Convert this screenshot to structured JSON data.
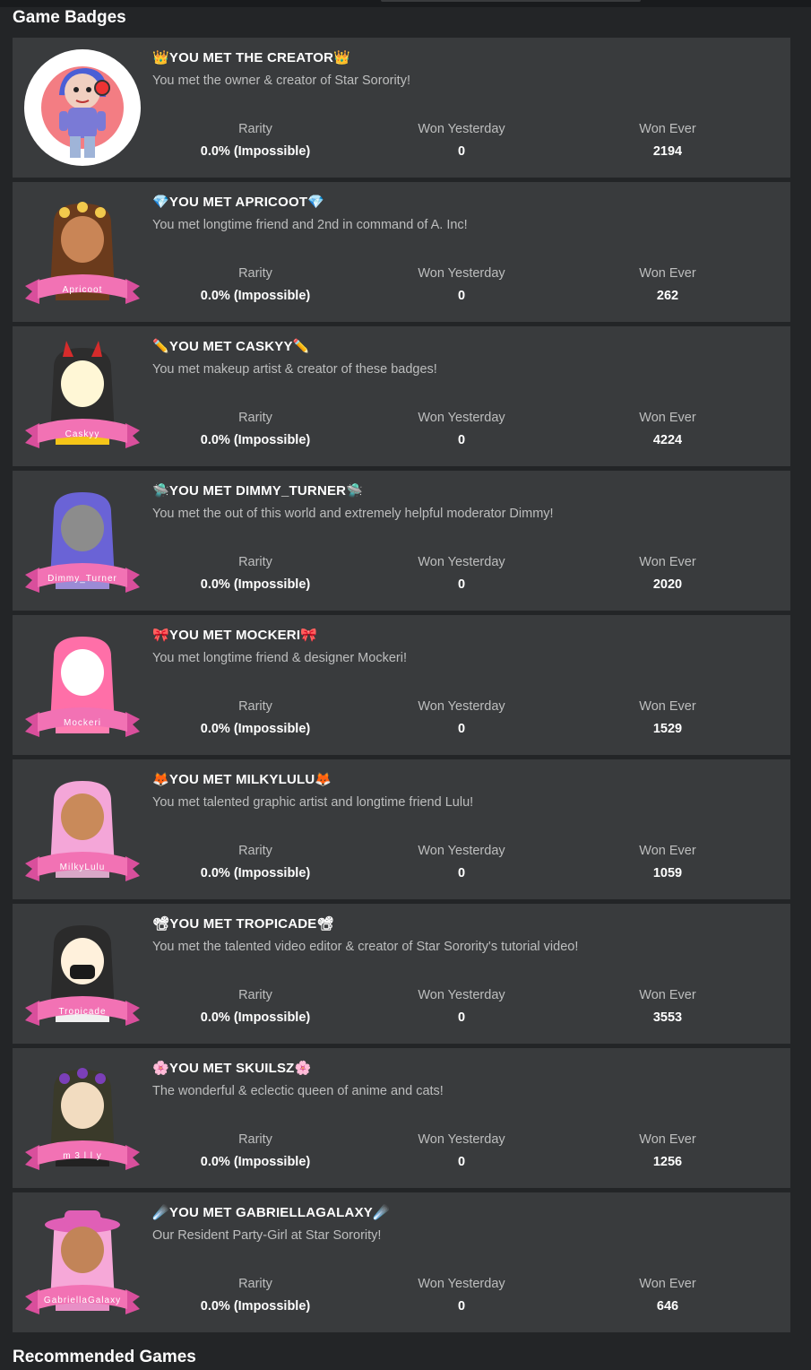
{
  "headings": {
    "game_badges": "Game Badges",
    "recommended_games": "Recommended Games"
  },
  "stat_labels": {
    "rarity": "Rarity",
    "won_yesterday": "Won Yesterday",
    "won_ever": "Won Ever"
  },
  "colors": {
    "page_background": "#232527",
    "card_background": "#393b3d",
    "secondary_text": "#bdbebe",
    "banner_pink": "#f272b4"
  },
  "badges": [
    {
      "icon": "crown-emoji",
      "name": "👑YOU MET THE CREATOR👑",
      "description": "You met the owner & creator of Star Sorority!",
      "rarity": "0.0% (Impossible)",
      "won_yesterday": "0",
      "won_ever": "2194",
      "image": "creator-avatar-circle"
    },
    {
      "icon": "gem-emoji",
      "name": "💎YOU MET APRICOOT💎",
      "description": "You met longtime friend and 2nd in command of A. Inc!",
      "rarity": "0.0% (Impossible)",
      "won_yesterday": "0",
      "won_ever": "262",
      "image": "avatar-with-banner",
      "banner": "Apricoot"
    },
    {
      "icon": "pencil-emoji",
      "name": "✏️YOU MET CASKYY✏️",
      "description": "You met makeup artist & creator of these badges!",
      "rarity": "0.0% (Impossible)",
      "won_yesterday": "0",
      "won_ever": "4224",
      "image": "avatar-with-banner",
      "banner": "Caskyy"
    },
    {
      "icon": "ufo-emoji",
      "name": "🛸YOU MET DIMMY_TURNER🛸",
      "description": "You met the out of this world and extremely helpful moderator Dimmy!",
      "rarity": "0.0% (Impossible)",
      "won_yesterday": "0",
      "won_ever": "2020",
      "image": "avatar-with-banner",
      "banner": "Dimmy_Turner"
    },
    {
      "icon": "ribbon-emoji",
      "name": "🎀YOU MET MOCKERI🎀",
      "description": "You met longtime friend & designer Mockeri!",
      "rarity": "0.0% (Impossible)",
      "won_yesterday": "0",
      "won_ever": "1529",
      "image": "avatar-with-banner",
      "banner": "Mockeri"
    },
    {
      "icon": "fox-emoji",
      "name": "🦊YOU MET MILKYLULU🦊",
      "description": "You met talented graphic artist and longtime friend Lulu!",
      "rarity": "0.0% (Impossible)",
      "won_yesterday": "0",
      "won_ever": "1059",
      "image": "avatar-with-banner",
      "banner": "MilkyLulu"
    },
    {
      "icon": "film-camera-emoji",
      "name": "📽YOU MET TROPICADE📽",
      "description": "You met the talented video editor & creator of Star Sorority's tutorial video!",
      "rarity": "0.0% (Impossible)",
      "won_yesterday": "0",
      "won_ever": "3553",
      "image": "avatar-with-banner",
      "banner": "Tropicade"
    },
    {
      "icon": "cherry-blossom-emoji",
      "name": "🌸YOU MET SKUILSZ🌸",
      "description": "The wonderful & eclectic queen of anime and cats!",
      "rarity": "0.0% (Impossible)",
      "won_yesterday": "0",
      "won_ever": "1256",
      "image": "avatar-with-banner",
      "banner": "m 3 l l y"
    },
    {
      "icon": "comet-emoji",
      "name": "☄️YOU MET GABRIELLAGALAXY☄️",
      "description": "Our Resident Party-Girl at Star Sorority!",
      "rarity": "0.0% (Impossible)",
      "won_yesterday": "0",
      "won_ever": "646",
      "image": "avatar-with-banner",
      "banner": "GabriellaGalaxy"
    }
  ]
}
